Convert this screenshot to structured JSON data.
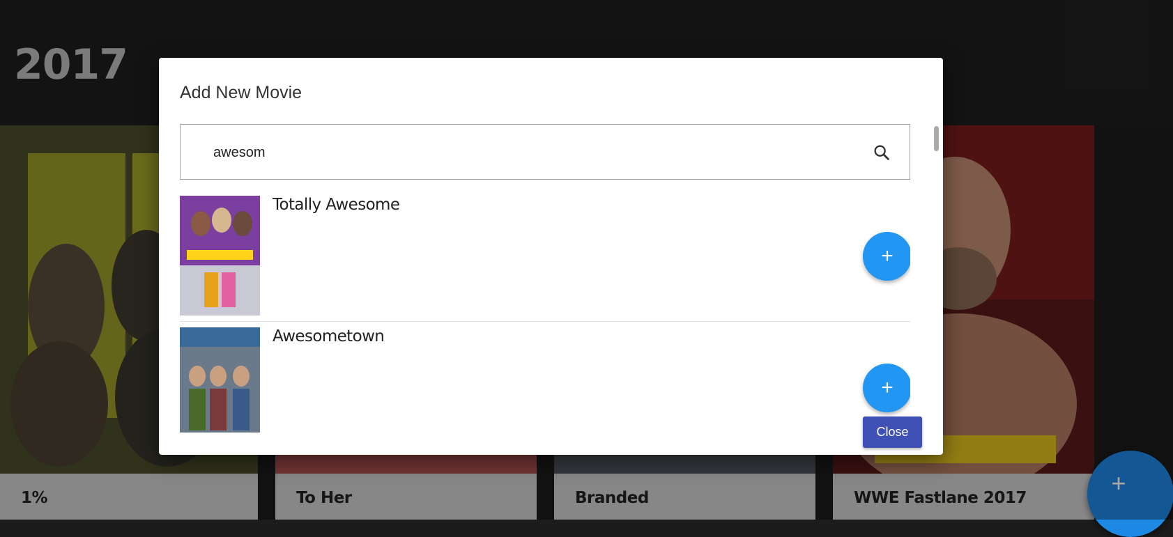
{
  "page": {
    "year": "2017"
  },
  "cards": [
    {
      "title": "1%"
    },
    {
      "title": "To Her"
    },
    {
      "title": "Branded"
    },
    {
      "title": "WWE Fastlane 2017"
    }
  ],
  "fab": {
    "label": "+"
  },
  "dialog": {
    "title": "Add New Movie",
    "search": {
      "value": "awesom"
    },
    "results": [
      {
        "title": "Totally Awesome",
        "add_label": "+"
      },
      {
        "title": "Awesometown",
        "add_label": "+"
      }
    ],
    "close_label": "Close"
  },
  "colors": {
    "accent": "#2196f3",
    "close_button": "#3f51b5",
    "background": "#1c1c1c"
  },
  "icons": {
    "search": "search-icon",
    "add": "plus-icon"
  }
}
